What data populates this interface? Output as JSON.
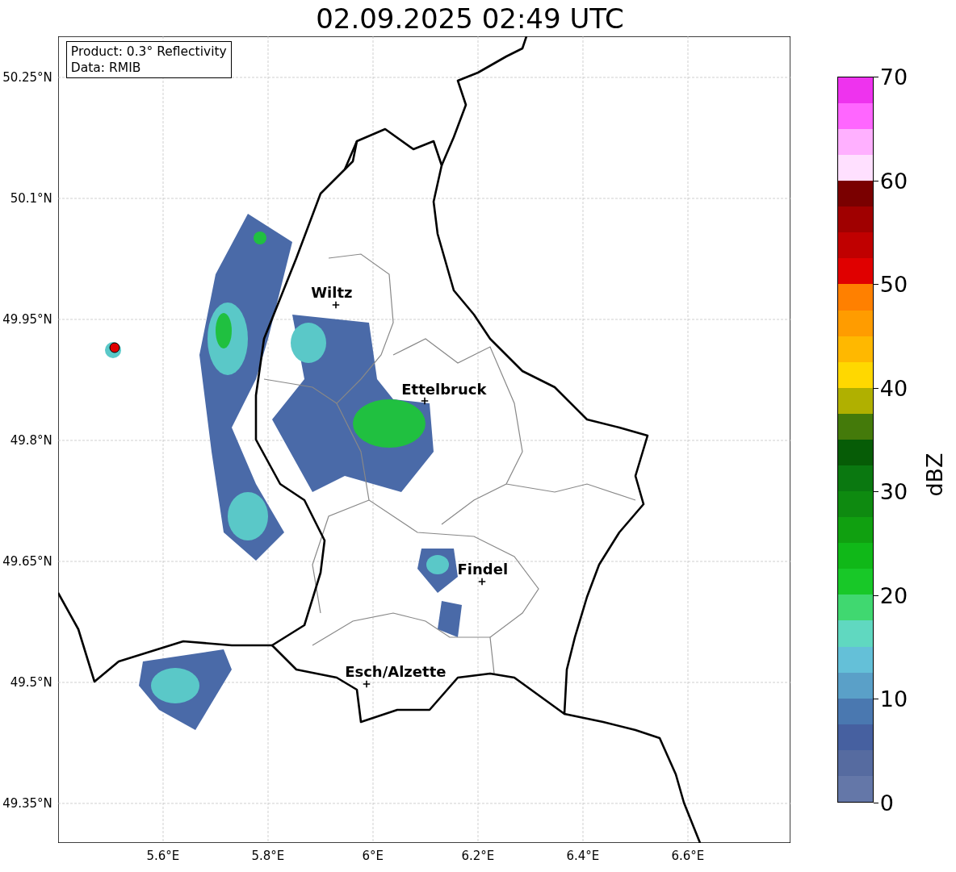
{
  "title": "02.09.2025 02:49 UTC",
  "info_box": {
    "lines": [
      "Product: 0.3° Reflectivity",
      "Data: RMIB"
    ]
  },
  "map": {
    "lat_ticks": [
      "50.25°N",
      "50.1°N",
      "49.95°N",
      "49.8°N",
      "49.65°N",
      "49.5°N",
      "49.35°N"
    ],
    "lon_ticks": [
      "5.6°E",
      "5.8°E",
      "6°E",
      "6.2°E",
      "6.4°E",
      "6.6°E"
    ],
    "places": [
      {
        "name": "Wiltz"
      },
      {
        "name": "Ettelbruck"
      },
      {
        "name": "Findel"
      },
      {
        "name": "Esch/Alzette"
      }
    ]
  },
  "colorbar": {
    "label": "dBZ",
    "ticks": [
      "70",
      "60",
      "50",
      "40",
      "30",
      "20",
      "10",
      "0"
    ]
  }
}
